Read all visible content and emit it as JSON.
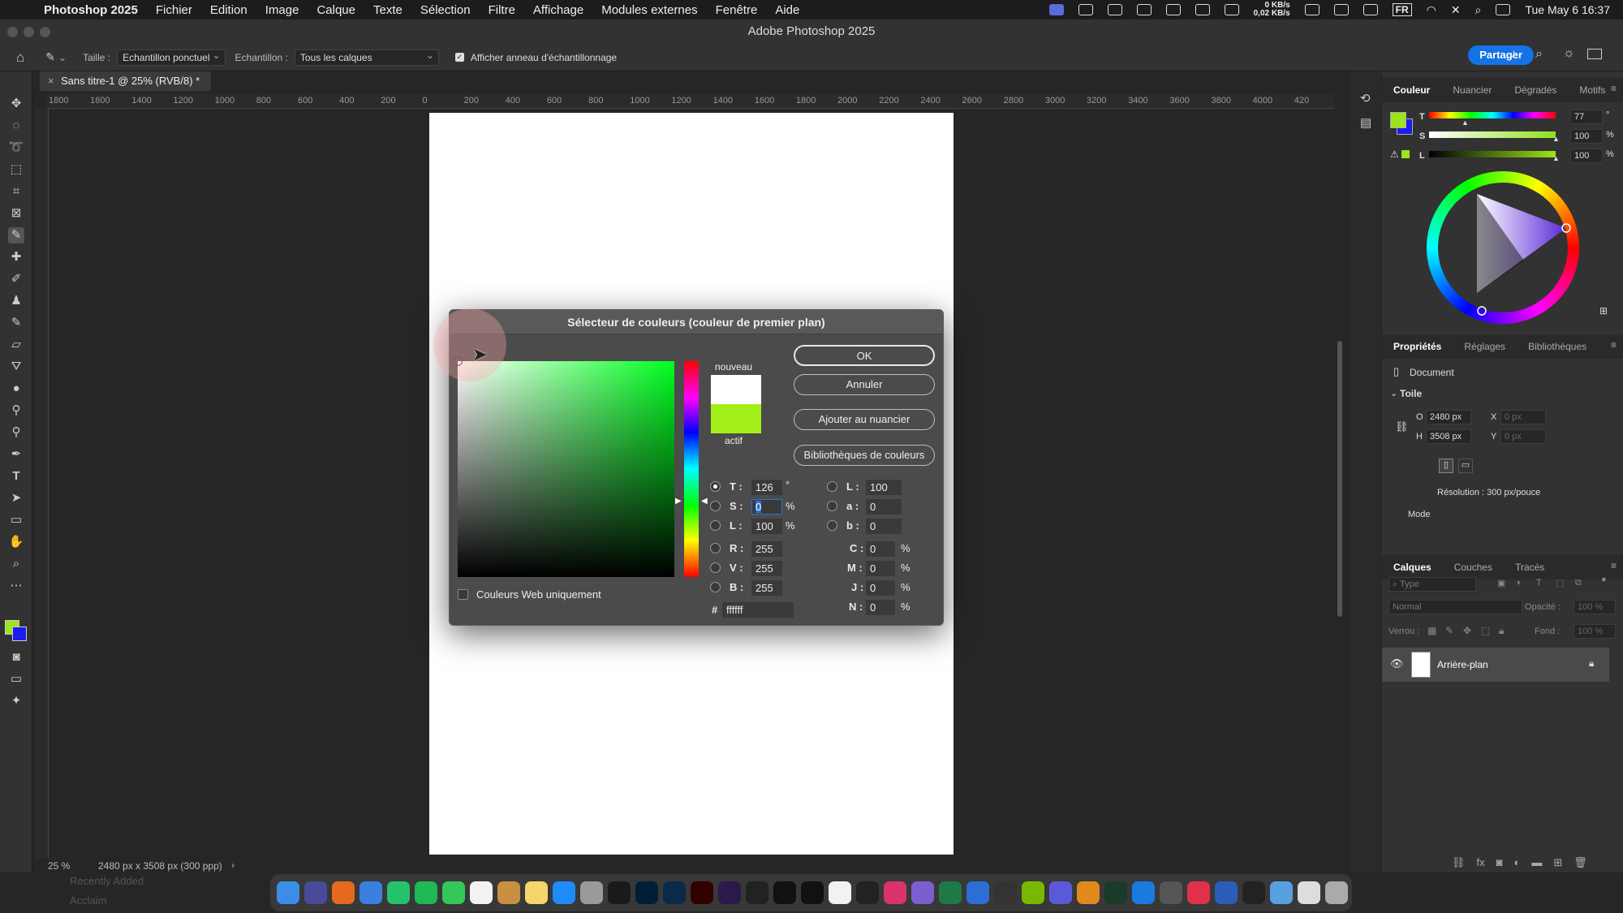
{
  "menubar": {
    "app_name": "Photoshop 2025",
    "items": [
      "Fichier",
      "Edition",
      "Image",
      "Calque",
      "Texte",
      "Sélection",
      "Filtre",
      "Affichage",
      "Modules externes",
      "Fenêtre",
      "Aide"
    ],
    "net_up": "0 KB/s",
    "net_down": "0,02 KB/s",
    "lang": "FR",
    "clock": "Tue May 6  16:37"
  },
  "window": {
    "title": "Adobe Photoshop 2025"
  },
  "options": {
    "size_label": "Taille :",
    "size_value": "Echantillon ponctuel",
    "sample_label": "Echantillon :",
    "sample_value": "Tous les calques",
    "ring_label": "Afficher anneau d'échantillonnage",
    "share_label": "Partager"
  },
  "document": {
    "tab_title": "Sans titre-1 @ 25% (RVB/8) *",
    "zoom": "25 %",
    "dimensions": "2480 px x 3508 px (300 ppp)"
  },
  "ruler": {
    "labels": [
      "1800",
      "1600",
      "1400",
      "1200",
      "1000",
      "800",
      "600",
      "400",
      "200",
      "0",
      "200",
      "400",
      "600",
      "800",
      "1000",
      "1200",
      "1400",
      "1600",
      "1800",
      "2000",
      "2200",
      "2400",
      "2600",
      "2800",
      "3000",
      "3200",
      "3400",
      "3600",
      "3800",
      "4000",
      "420"
    ]
  },
  "color_panel": {
    "tabs": [
      "Couleur",
      "Nuancier",
      "Dégradés",
      "Motifs"
    ],
    "t_label": "T",
    "t_value": "77",
    "t_unit": "°",
    "s_label": "S",
    "s_value": "100",
    "s_unit": "%",
    "l_label": "L",
    "l_value": "100",
    "l_unit": "%",
    "foreground": "#9be51a",
    "background": "#1c1cf0"
  },
  "properties_panel": {
    "tabs": [
      "Propriétés",
      "Réglages",
      "Bibliothèques"
    ],
    "doc_label": "Document",
    "section": "Toile",
    "w_label": "O",
    "w_value": "2480 px",
    "h_label": "H",
    "h_value": "3508 px",
    "x_label": "X",
    "x_value": "0 px",
    "y_label": "Y",
    "y_value": "0 px",
    "resolution": "Résolution : 300 px/pouce",
    "mode_label": "Mode"
  },
  "layers_panel": {
    "tabs": [
      "Calques",
      "Couches",
      "Tracés"
    ],
    "search_placeholder": "Type",
    "blend_mode": "Normal",
    "opacity_label": "Opacité :",
    "opacity_value": "100 %",
    "lock_label": "Verrou :",
    "fill_label": "Fond :",
    "fill_value": "100 %",
    "layer_name": "Arrière-plan"
  },
  "dialog": {
    "title": "Sélecteur de couleurs (couleur de premier plan)",
    "new_label": "nouveau",
    "current_label": "actif",
    "new_color": "#ffffff",
    "current_color": "#a4ef1a",
    "ok": "OK",
    "cancel": "Annuler",
    "add_swatch": "Ajouter au nuancier",
    "libraries": "Bibliothèques de couleurs",
    "web_only": "Couleurs Web uniquement",
    "fields": {
      "T": "126",
      "S": "0",
      "L": "100",
      "R": "255",
      "V": "255",
      "B": "255",
      "Lab_L": "100",
      "a": "0",
      "b": "0",
      "C": "0",
      "M": "0",
      "J": "0",
      "N": "0",
      "hex": "ffffff"
    },
    "labels": {
      "T": "T :",
      "S": "S :",
      "L": "L :",
      "R": "R :",
      "V": "V :",
      "B": "B :",
      "Lab_L": "L :",
      "a": "a :",
      "b": "b :",
      "C": "C :",
      "M": "M :",
      "J": "J :",
      "N": "N :",
      "hash": "#",
      "deg": "°",
      "pct": "%"
    }
  },
  "finder_sidebar": [
    "Recently Added",
    "Acclaim"
  ]
}
